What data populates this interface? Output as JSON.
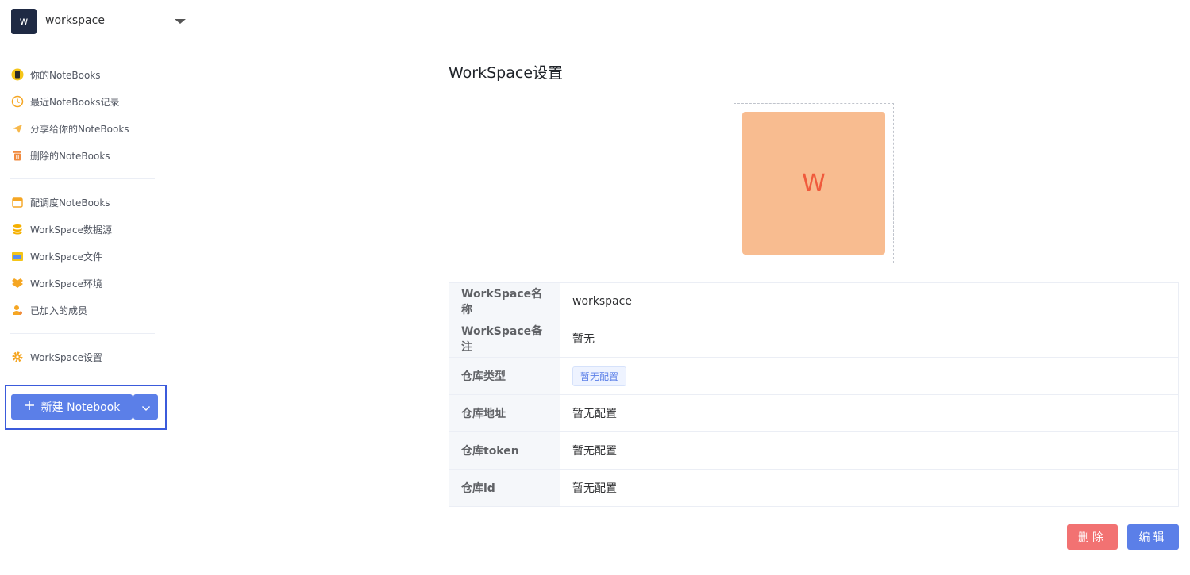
{
  "header": {
    "logo_letter": "w",
    "workspace_name": "workspace",
    "dropdown_icon": "caret-down-icon"
  },
  "sidebar": {
    "items": [
      {
        "label": "你的NoteBooks",
        "icon": "notebook-icon"
      },
      {
        "label": "最近NoteBooks记录",
        "icon": "clock-icon"
      },
      {
        "label": "分享给你的NoteBooks",
        "icon": "send-icon"
      },
      {
        "label": "删除的NoteBooks",
        "icon": "trash-icon"
      },
      {
        "label": "配调度NoteBooks",
        "icon": "calendar-icon"
      },
      {
        "label": "WorkSpace数据源",
        "icon": "database-icon"
      },
      {
        "label": "WorkSpace文件",
        "icon": "folder-icon"
      },
      {
        "label": "WorkSpace环境",
        "icon": "box-icon"
      },
      {
        "label": "已加入的成员",
        "icon": "user-icon"
      },
      {
        "label": "WorkSpace设置",
        "icon": "gear-icon"
      }
    ],
    "new_button": {
      "label": "新建 Notebook",
      "icon": "plus-icon",
      "dropdown_icon": "chevron-down-icon"
    }
  },
  "main": {
    "title": "WorkSpace设置",
    "avatar_letter": "W",
    "rows": [
      {
        "key": "WorkSpace名称",
        "value": "workspace"
      },
      {
        "key": "WorkSpace备注",
        "value": "暂无"
      },
      {
        "key": "仓库类型",
        "value": "暂无配置"
      },
      {
        "key": "仓库地址",
        "value": "暂无配置"
      },
      {
        "key": "仓库token",
        "value": "暂无配置"
      },
      {
        "key": "仓库id",
        "value": "暂无配置"
      }
    ],
    "delete_label": "删除",
    "edit_label": "编辑"
  },
  "colors": {
    "accent": "#5b7fe8",
    "danger": "#f27272",
    "avatar_bg": "#f8bc90",
    "avatar_text": "#f05a3c",
    "icon_orange": "#f5a623"
  }
}
